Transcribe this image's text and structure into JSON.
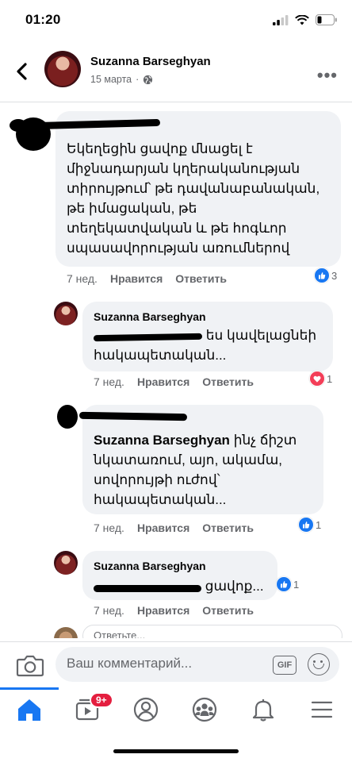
{
  "status": {
    "time": "01:20"
  },
  "header": {
    "name": "Suzanna Barseghyan",
    "date": "15 марта",
    "separator": "·",
    "more": "•••"
  },
  "comments": [
    {
      "author": "",
      "text_lines": [
        "Եկեղեցին ցավոք մնացել է",
        "միջնադարյան կղերականության",
        "տիրույթում՝ թե դավանաբանական,",
        "թե իմացական, թե",
        "տեղեկատվական և թե հոգևոր",
        "սպասավորության առումներով"
      ],
      "time": "7 нед.",
      "like": "Нравится",
      "reply": "Ответить",
      "reaction_count": "3"
    },
    {
      "author": "Suzanna Barseghyan",
      "line1_tail": "ես կավելացնեի",
      "line2": "հակապետական...",
      "time": "7 нед.",
      "like": "Нравится",
      "reply": "Ответить",
      "reaction_count": "1"
    },
    {
      "author": "",
      "line1_name": "Suzanna Barseghyan",
      "line1_tail": "ինչ ճիշտ",
      "lines": [
        "նկատառում, այո, ակամա,",
        "սովորույթի ուժով՝",
        "հակապետական..."
      ],
      "time": "7 нед.",
      "like": "Нравится",
      "reply": "Ответить",
      "reaction_count": "1"
    },
    {
      "author": "Suzanna Barseghyan",
      "line1_tail": "ցավոք...",
      "time": "7 нед.",
      "like": "Нравится",
      "reply": "Ответить",
      "reaction_count": "1"
    }
  ],
  "partial_reply": "Ответьте...",
  "composer": {
    "placeholder": "Ваш комментарий...",
    "gif": "GIF"
  },
  "tabs": {
    "badge": "9+",
    "items": [
      "home-icon",
      "video-icon",
      "profile-icon",
      "groups-icon",
      "bell-icon",
      "menu-icon"
    ]
  },
  "colors": {
    "accent": "#1877f2",
    "love": "#f33e58",
    "badge": "#e41e3f",
    "bubble": "#f0f2f5"
  }
}
